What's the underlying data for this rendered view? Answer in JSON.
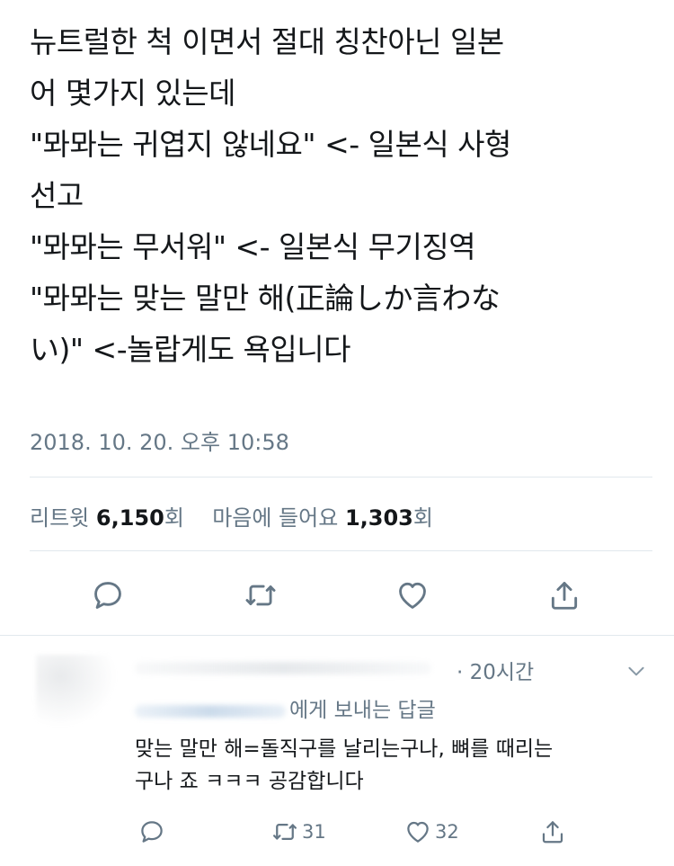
{
  "tweet": {
    "lines": [
      "뉴트럴한 척 이면서 절대 칭찬아닌 일본",
      "어 몇가지 있는데",
      "\"뫄뫄는 귀엽지 않네요\" <- 일본식 사형",
      "선고",
      "\"뫄뫄는 무서워\" <- 일본식 무기징역",
      "\"뫄뫄는 맞는 말만 해(正論しか言わな",
      "い)\" <-놀랍게도 욕입니다"
    ],
    "timestamp": "2018. 10. 20. 오후 10:58",
    "stats": {
      "retweet_label": "리트윗",
      "retweet_count": "6,150",
      "retweet_suffix": "회",
      "like_label": "마음에 들어요",
      "like_count": "1,303",
      "like_suffix": "회"
    },
    "actions": {
      "reply_icon": "reply-icon",
      "retweet_icon": "retweet-icon",
      "like_icon": "heart-icon",
      "share_icon": "share-icon"
    }
  },
  "reply": {
    "time": "· 20시간",
    "reply_to_suffix": "에게 보내는 답글",
    "lines": [
      "맞는 말만 해=돌직구를 날리는구나, 뼈를 때리는",
      "구나 죠 ㅋㅋㅋ 공감합니다"
    ],
    "retweet_count": "31",
    "like_count": "32"
  },
  "colors": {
    "text": "#14171a",
    "muted": "#657786",
    "divider": "#e1e8ed",
    "icon": "#657786"
  }
}
